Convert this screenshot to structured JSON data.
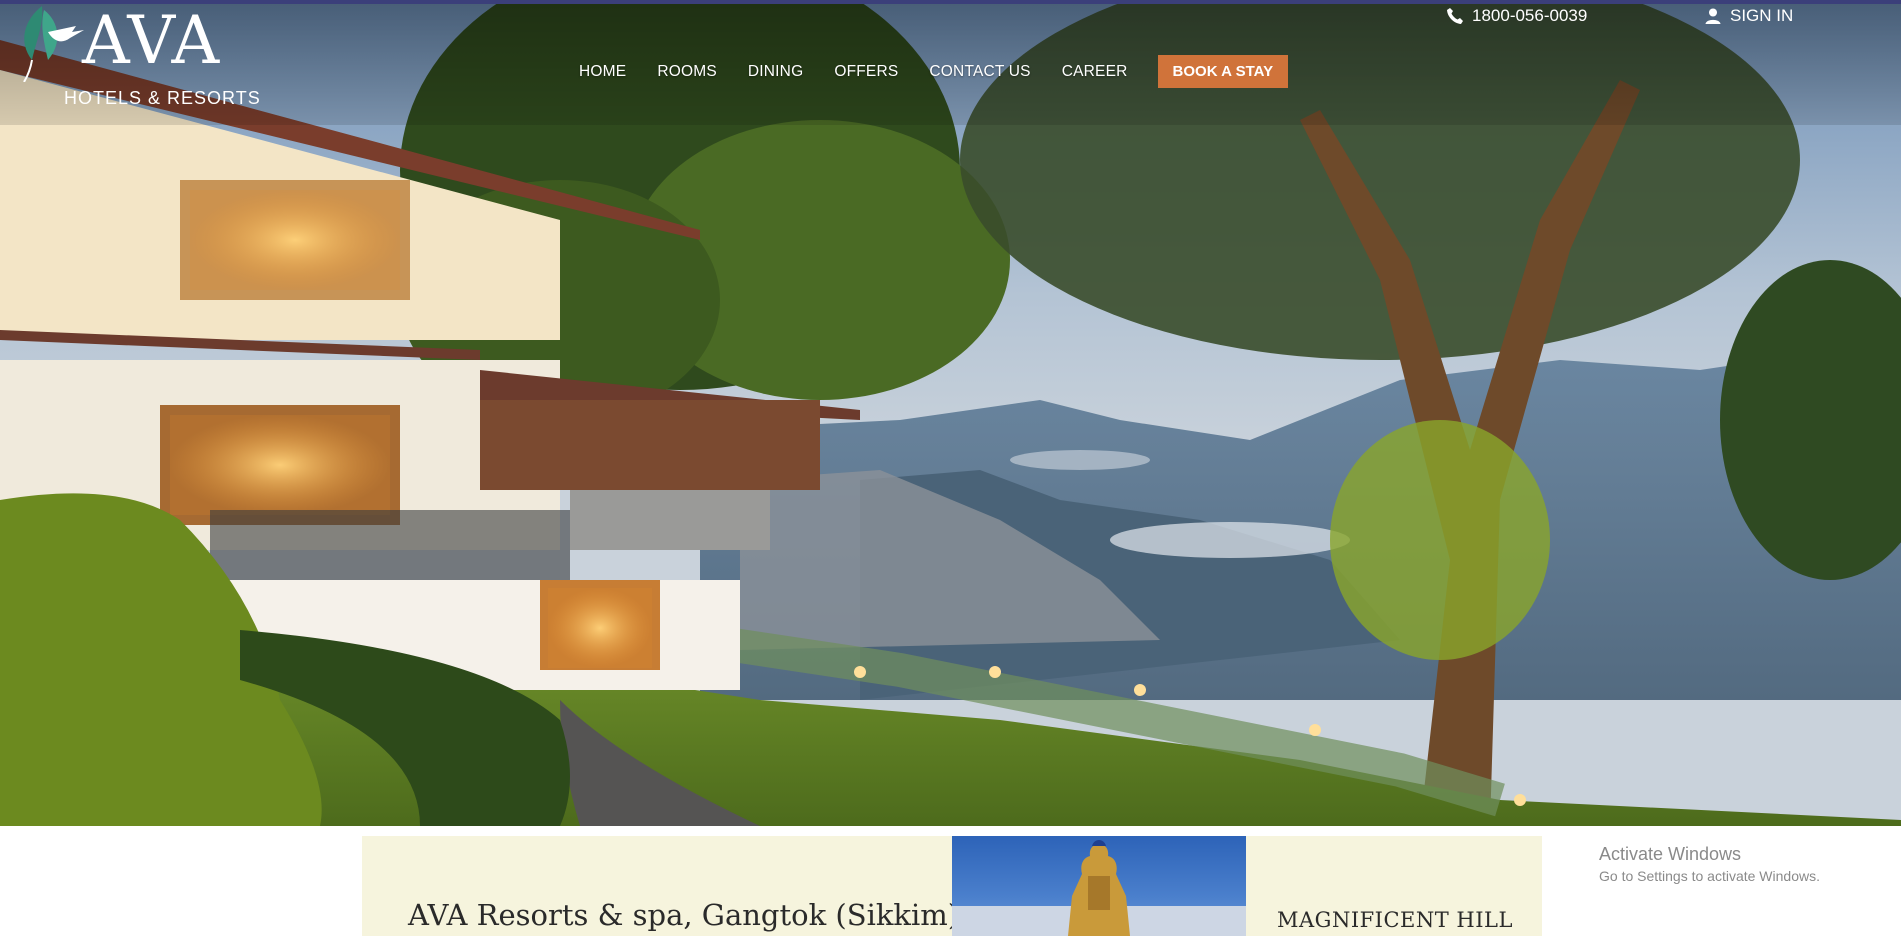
{
  "logo": {
    "brand": "AVA",
    "tagline": "HOTELS & RESORTS"
  },
  "topbar": {
    "phone": "1800-056-0039",
    "signin": "SIGN IN"
  },
  "nav": {
    "items": [
      "HOME",
      "ROOMS",
      "DINING",
      "OFFERS",
      "CONTACT US",
      "CAREER"
    ],
    "cta": "BOOK A STAY"
  },
  "intro": {
    "title": "AVA Resorts & spa, Gangtok (Sikkim)",
    "side_title": "MAGNIFICENT HILL"
  },
  "watermark": {
    "line1": "Activate Windows",
    "line2": "Go to Settings to activate Windows."
  },
  "colors": {
    "accent": "#d0733a",
    "intro_bg": "#f6f4dd"
  },
  "icons": {
    "logo": "hummingbird-leaf-icon",
    "phone": "phone-icon",
    "user": "user-icon"
  }
}
